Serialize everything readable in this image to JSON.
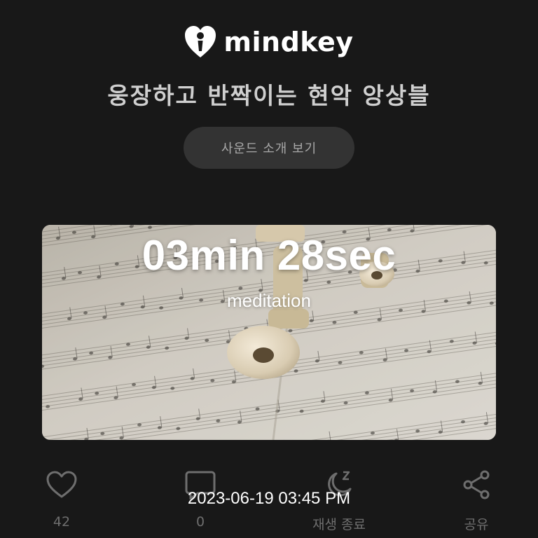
{
  "header": {
    "logo_text": "mindkey"
  },
  "sound": {
    "title": "웅장하고 반짝이는 현악 앙상블",
    "intro_button": "사운드 소개 보기"
  },
  "player": {
    "timer": "03min 28sec",
    "category": "meditation",
    "datetime": "2023-06-19 03:45 PM"
  },
  "actions": {
    "like": {
      "icon": "heart-icon",
      "count": "42"
    },
    "comment": {
      "icon": "comment-icon",
      "count": "0"
    },
    "sleep": {
      "icon": "moon-sleep-icon",
      "label": "재생 종료"
    },
    "share": {
      "icon": "share-icon",
      "label": "공유"
    }
  },
  "colors": {
    "background": "#181818",
    "button_bg": "#333333",
    "muted_text": "#6e6e6e",
    "title_text": "#cfcfcf"
  }
}
